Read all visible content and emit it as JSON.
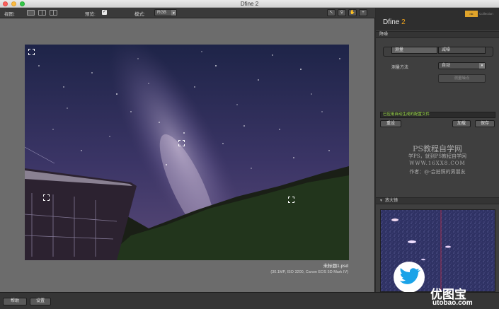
{
  "window": {
    "title": "Dfine 2"
  },
  "toolbar": {
    "view_label": "视图:",
    "preview_label": "预览:",
    "preview_check": "✓",
    "mode_label": "模式:",
    "mode_value": "RGB"
  },
  "preview": {
    "file_name": "未标题1.psd",
    "file_info": "(30.1MP, ISO 3200, Canon EOS 5D Mark IV)"
  },
  "panel": {
    "brand_name": "Dfine",
    "brand_version": "2",
    "nik_logo": "nik",
    "collection": "Collection",
    "section_reduce": "降噪",
    "tab_measure": "测量",
    "tab_reduce": "减噪",
    "method_label": "测量方法",
    "method_value": "自动",
    "measure_noise_button": "测量噪点",
    "status_text": "已应用自动生成的配置文件",
    "reset_button": "重设",
    "load_button": "加载",
    "save_button": "保存",
    "loupe_title": "放大镜"
  },
  "watermark": {
    "line1": "PS教程自学网",
    "line2": "学PS，就到PS教程自学网",
    "line3": "WWW.16XX8.COM",
    "line4": "作者：@-会拍照的男朋友"
  },
  "bottom": {
    "help_button": "帮助",
    "settings_button": "设置",
    "site_logo": "优图宝",
    "site_url": "utobao.com"
  },
  "colors": {
    "accent": "#f2a51c",
    "status_green": "#9fe04a"
  }
}
